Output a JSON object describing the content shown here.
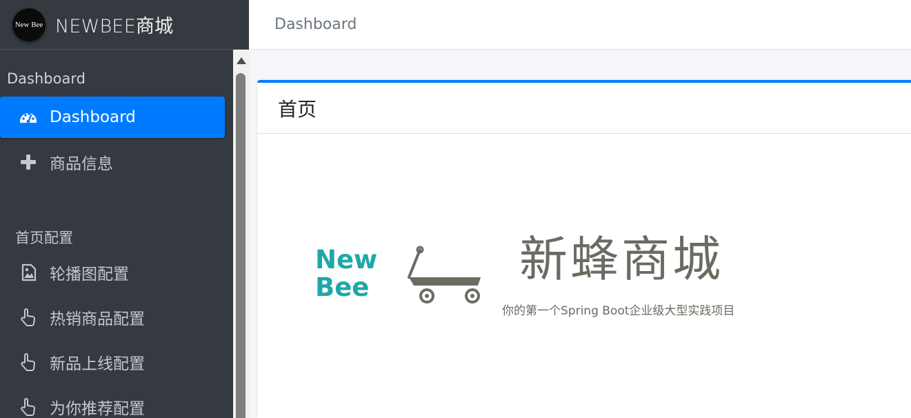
{
  "brand": {
    "logo_text": "New Bee",
    "title": "NEWBEE商城"
  },
  "sidebar": {
    "section_main": "Dashboard",
    "items_main": [
      {
        "label": "Dashboard",
        "icon": "dashboard-icon",
        "active": true
      },
      {
        "label": "商品信息",
        "icon": "plus-icon",
        "active": false
      }
    ],
    "section_home": "首页配置",
    "items_home": [
      {
        "label": "轮播图配置",
        "icon": "image-icon"
      },
      {
        "label": "热销商品配置",
        "icon": "pointer-hand-icon"
      },
      {
        "label": "新品上线配置",
        "icon": "pointer-hand-icon"
      },
      {
        "label": "为你推荐配置",
        "icon": "pointer-hand-icon"
      }
    ]
  },
  "topbar": {
    "title": "Dashboard"
  },
  "card": {
    "title": "首页"
  },
  "hero": {
    "logo_line1": "New",
    "logo_line2": "Bee",
    "title": "新蜂商城",
    "subtitle": "你的第一个Spring Boot企业级大型实践项目"
  },
  "colors": {
    "accent": "#007bff",
    "sidebar_bg": "#343a40",
    "logo_teal": "#1fa7a8",
    "wagon_gray": "#6b6b62"
  }
}
